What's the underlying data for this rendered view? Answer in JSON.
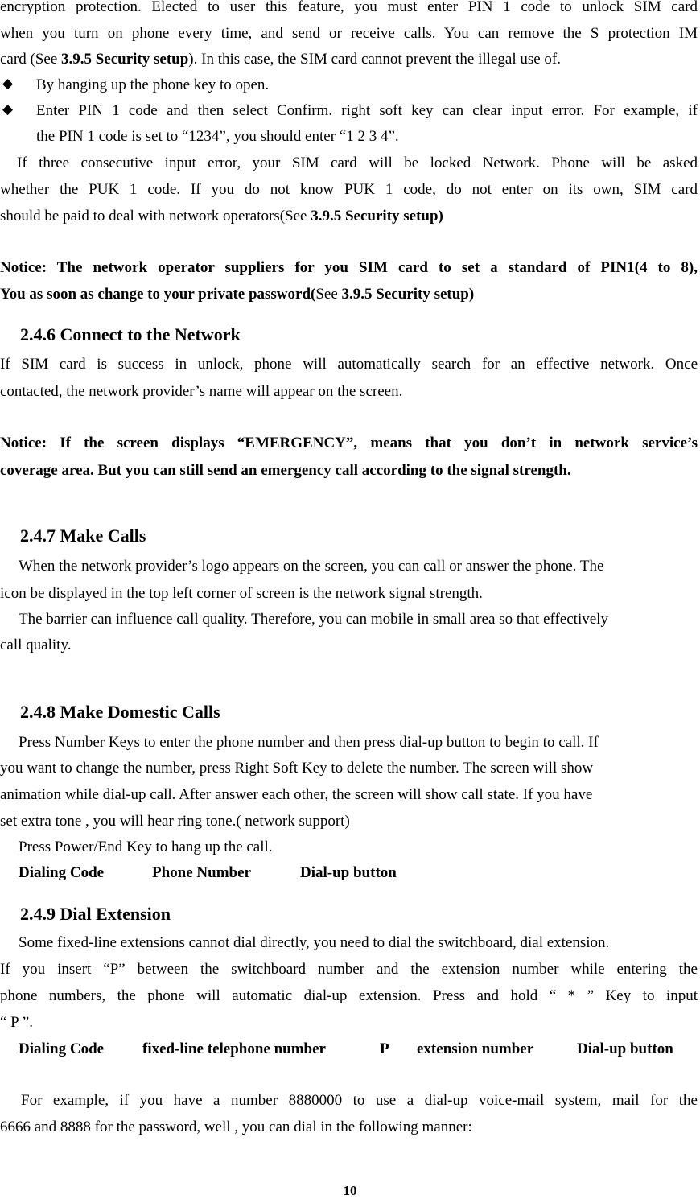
{
  "page": {
    "number": "10",
    "intro": {
      "lines": [
        "encryption protection. Elected to user this feature, you must enter PIN 1 code to unlock SIM card",
        "when you turn on phone every time, and send or receive calls. You can remove the S protection IM"
      ],
      "line3_pre": "card (See ",
      "line3_ref": "3.9.5 Security setup",
      "line3_post": "). In this case, the SIM card cannot prevent the illegal use of."
    },
    "bullets": [
      {
        "icon": "diamond-bullet",
        "glyph": "◆",
        "lines": [
          "By hanging up the phone key to open."
        ]
      },
      {
        "icon": "diamond-bullet",
        "glyph": "◆",
        "lines": [
          "Enter PIN 1 code and then select Confirm. right soft key can clear input error. For example, if",
          "the PIN 1 code is set to “1234”, you should enter “1 2 3 4”."
        ]
      }
    ],
    "puk": {
      "line1": "If three consecutive input error, your SIM card will be locked Network. Phone will be asked",
      "line2": "whether the PUK 1 code. If you do not know PUK 1 code, do not enter on its own, SIM card",
      "line3_pre": "should be paid to deal with network operators(See ",
      "line3_ref": "3.9.5 Security setup)"
    },
    "notice1": {
      "line1": "Notice: The network operator suppliers for you SIM card to set a standard of PIN1(4 to 8),",
      "line2_bold": "You as soon as change to your private password(",
      "line2_see": "See ",
      "line2_ref": "3.9.5 Security setup)"
    },
    "sections": {
      "s246": {
        "heading": "2.4.6 Connect to the Network",
        "lines": [
          "If SIM card is success in unlock, phone will automatically search for an effective network. Once",
          "contacted, the network provider’s name will appear on the screen."
        ],
        "notice_lines": [
          "Notice: If the screen displays “EMERGENCY”, means that you don’t in network service’s",
          "coverage area. But you can still send an emergency call according to the signal strength."
        ]
      },
      "s247": {
        "heading": "2.4.7 Make Calls",
        "lines": [
          "When the network provider’s logo appears on the screen, you can call or answer the phone. The",
          "icon be displayed in the top left corner of screen is the network signal strength.",
          "The barrier can influence call quality. Therefore, you can mobile in small area so that effectively",
          "call quality."
        ]
      },
      "s248": {
        "heading": "2.4.8 Make Domestic Calls",
        "lines": [
          "Press Number Keys to enter the phone number and then press dial-up button to begin to call. If",
          "you want to change the number, press Right Soft Key to delete the number. The screen will show",
          "animation while dial-up call. After answer each other, the screen will show call state. If you have",
          "set extra tone ,    you will hear ring tone.( network support)",
          "Press Power/End Key to hang up the call."
        ],
        "codes": [
          "Dialing Code",
          "Phone Number",
          "Dial-up button"
        ]
      },
      "s249": {
        "heading": "2.4.9 Dial Extension",
        "lines": [
          "Some fixed-line extensions cannot dial directly, you need to dial the switchboard, dial extension.",
          "If you insert “P” between the switchboard number and the extension number while entering the",
          "phone numbers, the phone will automatic dial-up extension. Press and hold “ * ”   Key to input",
          "“ P ”."
        ],
        "codes": [
          "Dialing Code",
          "fixed-line telephone number",
          "P",
          "extension number",
          "Dial-up button"
        ],
        "example_lines": [
          "For example, if you have a number 8880000 to use a dial-up voice-mail system, mail for the",
          "6666 and 8888 for the password, well , you can dial in the following manner:"
        ]
      }
    }
  }
}
